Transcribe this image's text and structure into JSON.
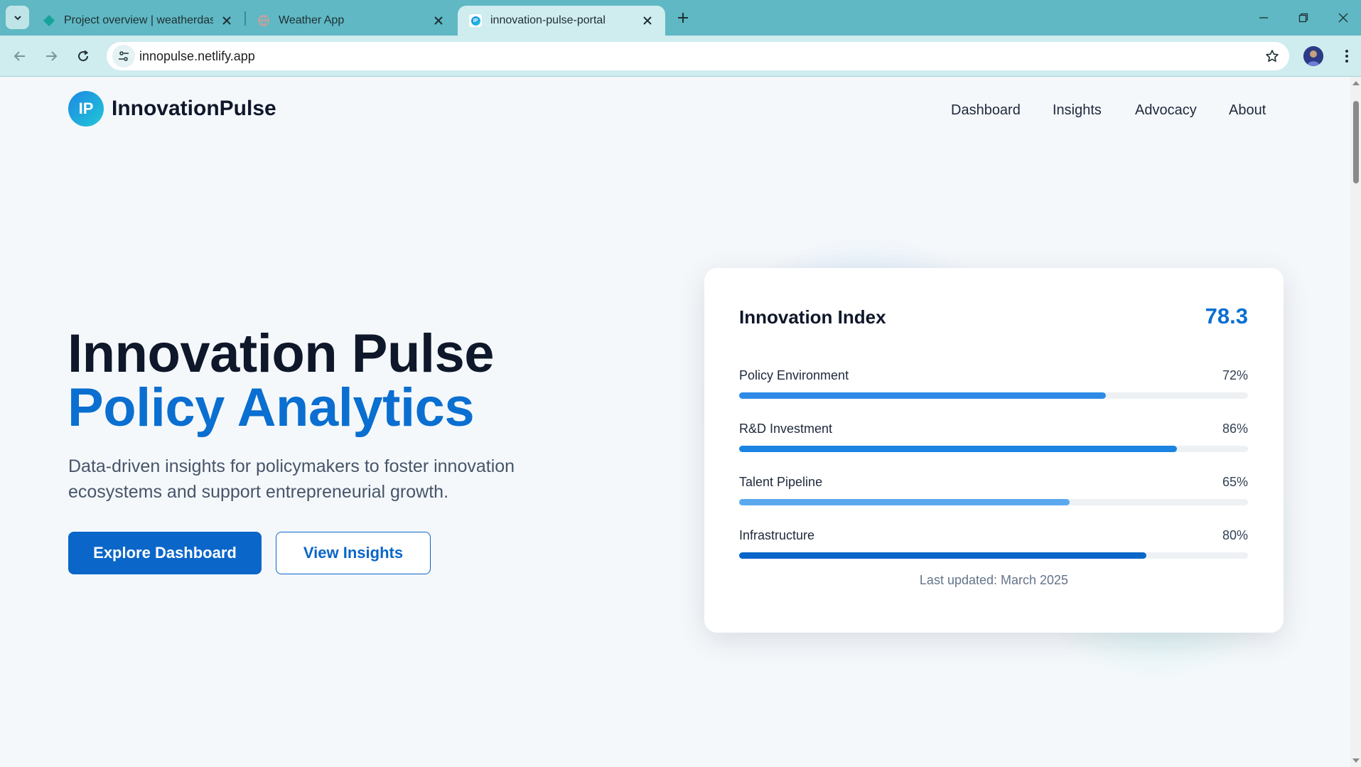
{
  "browser": {
    "tabs": [
      {
        "title": "Project overview | weatherdash",
        "active": false
      },
      {
        "title": "Weather App",
        "active": false
      },
      {
        "title": "innovation-pulse-portal",
        "active": true
      }
    ],
    "url": "innopulse.netlify.app"
  },
  "site": {
    "logo_initials": "IP",
    "brand": "InnovationPulse",
    "nav": [
      "Dashboard",
      "Insights",
      "Advocacy",
      "About"
    ]
  },
  "hero": {
    "title_line1": "Innovation Pulse",
    "title_line2": "Policy Analytics",
    "subtitle": "Data-driven insights for policymakers to foster innovation ecosystems and support entrepreneurial growth.",
    "primary_button": "Explore Dashboard",
    "secondary_button": "View Insights"
  },
  "card": {
    "title": "Innovation Index",
    "score": "78.3",
    "metrics": [
      {
        "label": "Policy Environment",
        "pct_text": "72%",
        "value": 72,
        "color": "#2f8ae6"
      },
      {
        "label": "R&D Investment",
        "pct_text": "86%",
        "value": 86,
        "color": "#1b84e3"
      },
      {
        "label": "Talent Pipeline",
        "pct_text": "65%",
        "value": 65,
        "color": "#5aa9ef"
      },
      {
        "label": "Infrastructure",
        "pct_text": "80%",
        "value": 80,
        "color": "#0a66c8"
      }
    ],
    "updated": "Last updated: March 2025"
  }
}
